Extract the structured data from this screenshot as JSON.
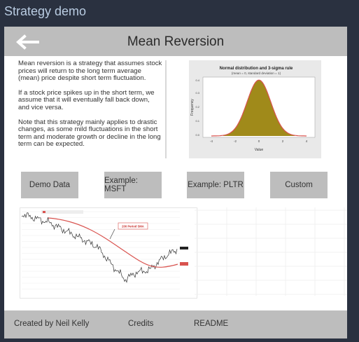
{
  "app": {
    "title": "Strategy demo"
  },
  "header": {
    "title": "Mean Reversion",
    "back_icon": "arrow-left-icon"
  },
  "description": {
    "paragraphs": [
      "Mean reversion is a strategy that assumes stock prices will return to the long term average (mean) price despite short term fluctuation.",
      "If a stock price spikes up in the short term, we assume that it will eventually fall back down, and vice versa.",
      "Note that this strategy mainly applies to drastic changes, as some mild fluctuations in the short term and moderate growth or decline in the long term can be expected."
    ]
  },
  "distribution_image": {
    "title": "Normal distribution and 3-sigma rule",
    "subtitle": "(mean = 0, standard deviation = 1)",
    "xlabel": "Value",
    "ylabel": "Frequency",
    "x_ticks": [
      "-4",
      "-2",
      "0",
      "2",
      "4"
    ],
    "y_ticks": [
      "0.0",
      "0.1",
      "0.2",
      "0.3",
      "0.4"
    ]
  },
  "buttons": [
    {
      "label": "Demo Data"
    },
    {
      "label": "Example: MSFT"
    },
    {
      "label": "Example: PLTR"
    },
    {
      "label": "Custom"
    }
  ],
  "stock_chart": {
    "annotation": "200 Period SMA"
  },
  "footer": {
    "created_by": "Created by Neil Kelly",
    "credits": "Credits",
    "readme": "README"
  },
  "colors": {
    "background": "#2a3140",
    "title_text": "#b9cce2",
    "bar_gray": "#bdbdbd",
    "curve_red": "#d9534f",
    "fill_olive": "#a08a1a"
  }
}
